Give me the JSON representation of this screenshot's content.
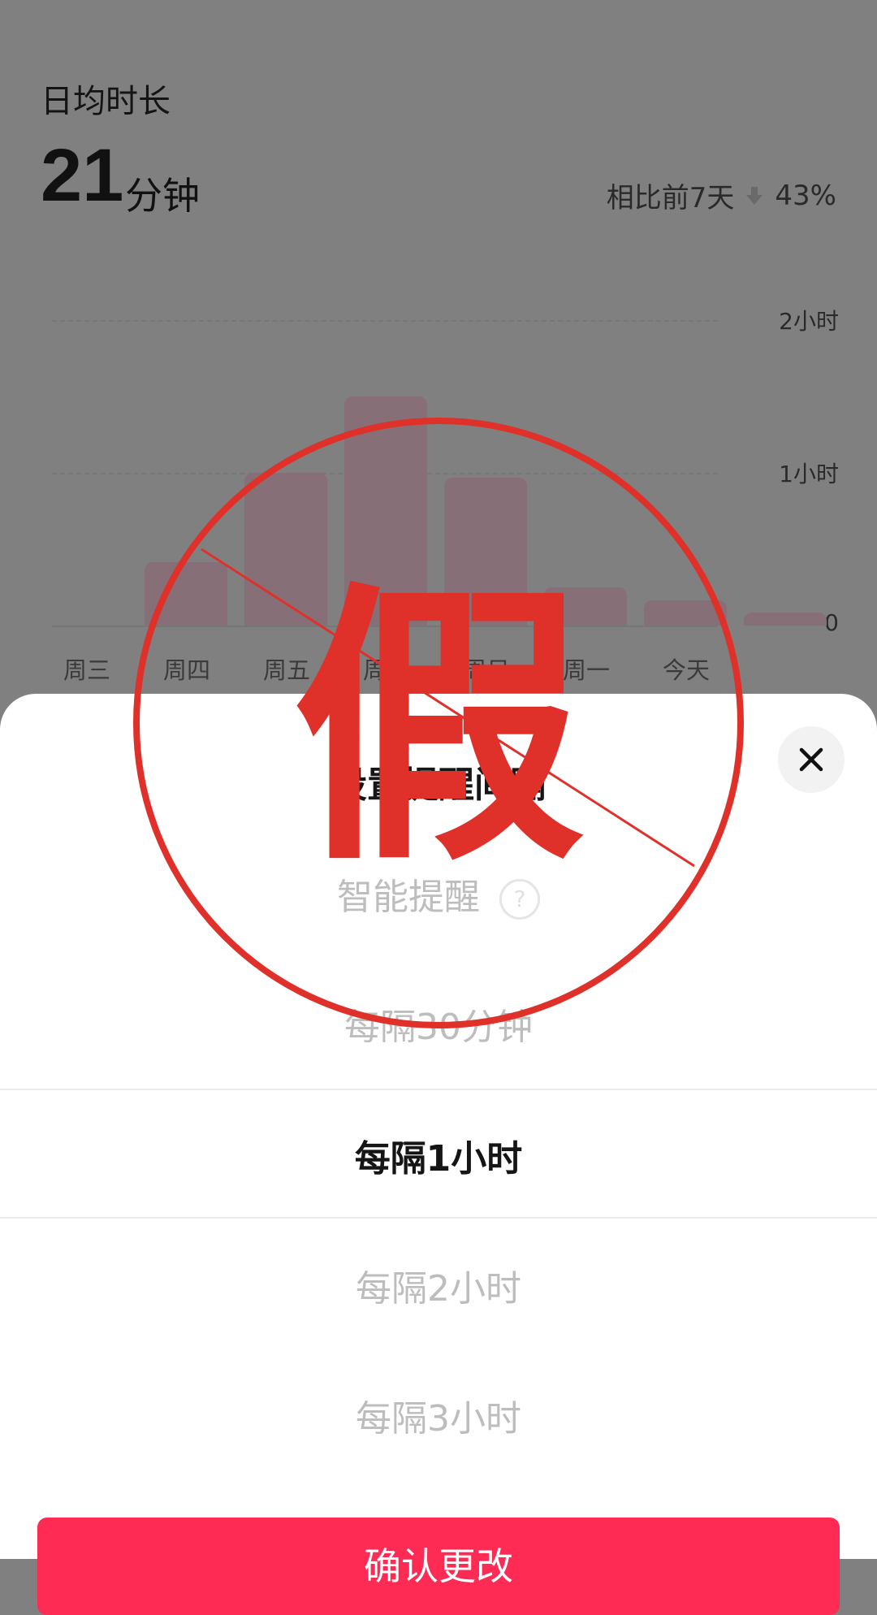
{
  "stats": {
    "title": "日均时长",
    "value": "21",
    "unit": "分钟",
    "compare_label": "相比前7天",
    "compare_value": "43%",
    "compare_direction": "down",
    "y_labels": [
      "2小时",
      "1小时",
      "0"
    ]
  },
  "chart_data": {
    "type": "bar",
    "categories": [
      "周三",
      "周四",
      "周五",
      "周六",
      "周日",
      "周一",
      "今天"
    ],
    "values": [
      25,
      60,
      90,
      58,
      15,
      10,
      5
    ],
    "value_unit": "minutes",
    "ylim": [
      0,
      120
    ],
    "y_ticks": [
      "0",
      "1小时",
      "2小时"
    ],
    "grid": true
  },
  "sheet": {
    "title": "设置提醒间隔",
    "options": [
      {
        "label": "智能提醒",
        "has_help": true,
        "selected": false
      },
      {
        "label": "每隔30分钟",
        "selected": false
      },
      {
        "label": "每隔1小时",
        "selected": true
      },
      {
        "label": "每隔2小时",
        "selected": false
      },
      {
        "label": "每隔3小时",
        "selected": false
      }
    ],
    "help_glyph": "?",
    "confirm_label": "确认更改"
  },
  "stamp": {
    "text": "假",
    "color": "#e0302a"
  },
  "colors": {
    "accent": "#fe2c55",
    "overlay": "#808080",
    "bar": "#866f76"
  },
  "icons": [
    "down-arrow-icon",
    "close-icon",
    "help-icon"
  ]
}
